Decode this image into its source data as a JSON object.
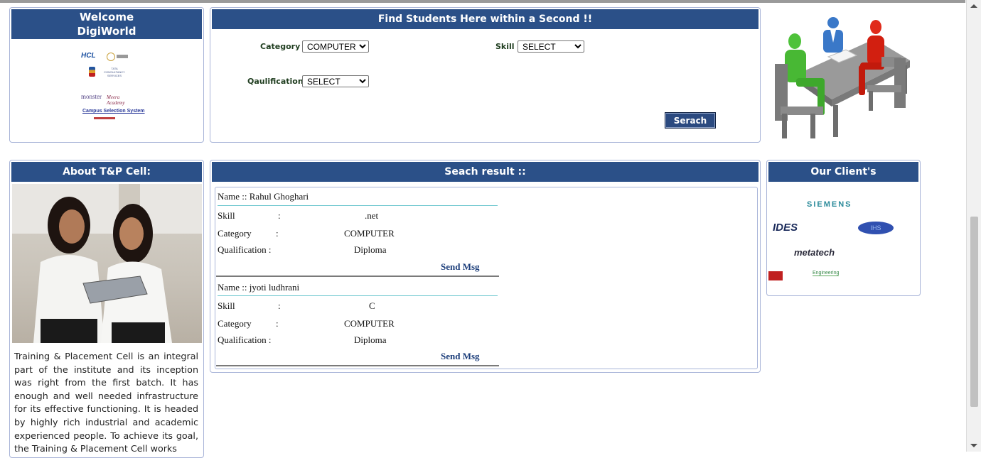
{
  "welcome": {
    "line1": "Welcome",
    "line2": "DigiWorld"
  },
  "welcome_logos": [
    "HCL",
    "TATA CONSULTANCY SERVICES",
    "monster",
    "Meera Academy",
    "Campus Selection System"
  ],
  "search_panel": {
    "title": "Find Students Here within a Second !!",
    "category_label": "Category  :",
    "category_value": "COMPUTER",
    "skill_label": "Skill :",
    "skill_value": "SELECT",
    "qualification_label": "Qaulification :",
    "qualification_value": "SELECT",
    "search_button": "Serach"
  },
  "about": {
    "title": "About T&P Cell:",
    "text": "Training & Placement Cell is an integral part of the institute and its inception was right from the first batch. It has enough and well needed infrastructure for its effective functioning. It is headed by highly rich industrial and academic experienced people. To achieve its goal, the Training & Placement Cell works"
  },
  "results": {
    "title": "Seach  result ::",
    "items": [
      {
        "name_label": "Name  :: Rahul   Ghoghari",
        "skill_label": "Skill",
        "skill_colon": ":",
        "skill": ".net",
        "category_label": "Category",
        "category_colon": ":",
        "category": "COMPUTER",
        "qualification_label": "Qualification :",
        "qualification": "Diploma",
        "send": "Send Msg"
      },
      {
        "name_label": "Name  :: jyoti   ludhrani",
        "skill_label": "Skill",
        "skill_colon": ":",
        "skill": "C",
        "category_label": "Category",
        "category_colon": ":",
        "category": "COMPUTER",
        "qualification_label": "Qualification :",
        "qualification": "Diploma",
        "send": "Send Msg"
      }
    ]
  },
  "clients": {
    "title": "Our Client's",
    "logos": [
      "SIEMENS",
      "IDES",
      "IHS",
      "metatech",
      "Engineering"
    ]
  },
  "colors": {
    "header_bg": "#2b5088",
    "panel_border": "#a8b4d8",
    "button_bg": "#2b4a80"
  }
}
